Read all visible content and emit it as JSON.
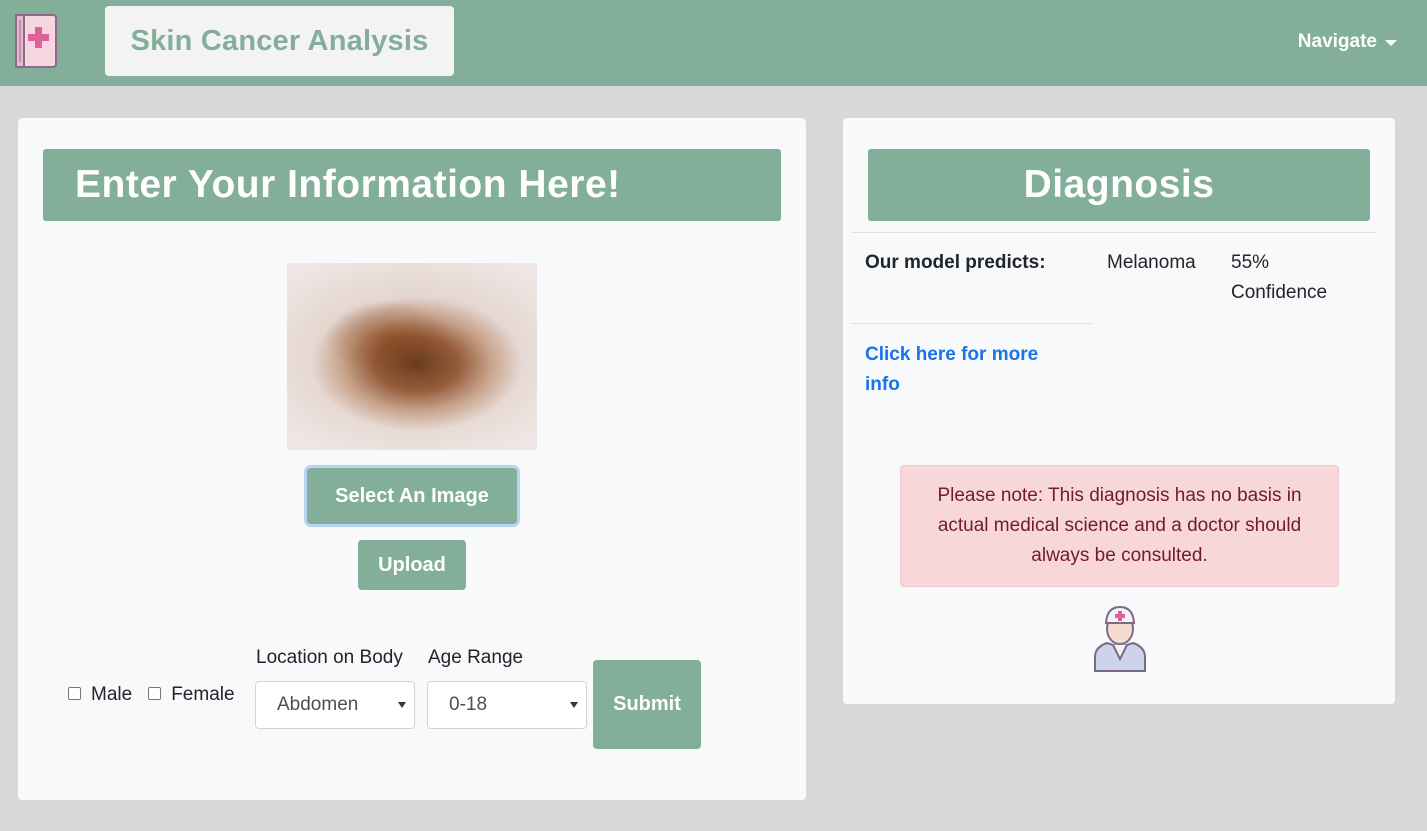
{
  "navbar": {
    "brand_icon": "medical-book-icon",
    "title": "Skin Cancer Analysis",
    "navigate_label": "Navigate",
    "accent_color": "#82ae9a"
  },
  "form_card": {
    "header": "Enter Your Information Here!",
    "image_alt": "skin lesion image",
    "select_image_label": "Select An Image",
    "upload_label": "Upload",
    "gender_options": [
      "Male",
      "Female"
    ],
    "location_label": "Location on Body",
    "location_value": "Abdomen",
    "age_label": "Age Range",
    "age_value": "0-18",
    "submit_label": "Submit"
  },
  "diagnosis_card": {
    "header": "Diagnosis",
    "predict_label": "Our model predicts:",
    "predicted_class": "Melanoma",
    "confidence": "55% Confidence",
    "more_info_link": "Click here for more info",
    "disclaimer": "Please note: This diagnosis has no basis in actual medical science and a doctor should always be consulted.",
    "doctor_icon": "doctor-icon"
  }
}
